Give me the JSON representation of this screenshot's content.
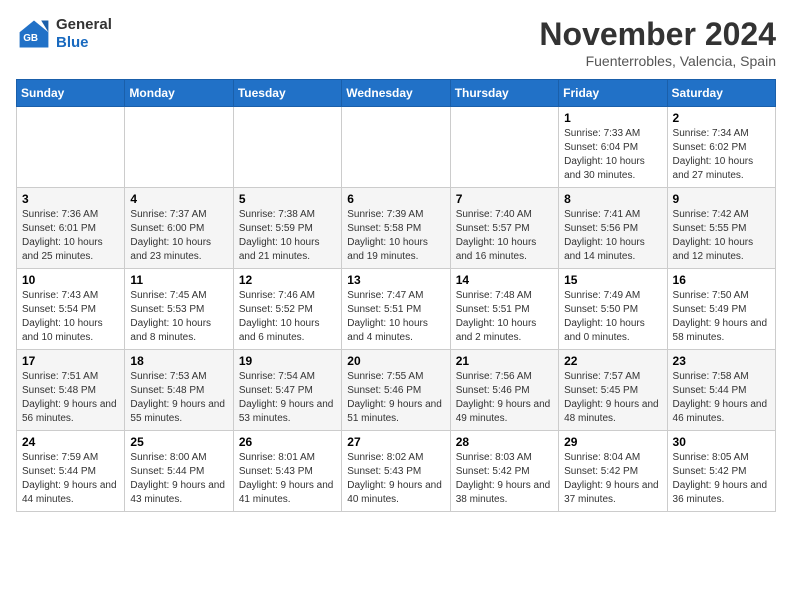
{
  "header": {
    "logo_line1": "General",
    "logo_line2": "Blue",
    "month": "November 2024",
    "location": "Fuenterrobles, Valencia, Spain"
  },
  "weekdays": [
    "Sunday",
    "Monday",
    "Tuesday",
    "Wednesday",
    "Thursday",
    "Friday",
    "Saturday"
  ],
  "weeks": [
    [
      {
        "day": "",
        "info": ""
      },
      {
        "day": "",
        "info": ""
      },
      {
        "day": "",
        "info": ""
      },
      {
        "day": "",
        "info": ""
      },
      {
        "day": "",
        "info": ""
      },
      {
        "day": "1",
        "info": "Sunrise: 7:33 AM\nSunset: 6:04 PM\nDaylight: 10 hours and 30 minutes."
      },
      {
        "day": "2",
        "info": "Sunrise: 7:34 AM\nSunset: 6:02 PM\nDaylight: 10 hours and 27 minutes."
      }
    ],
    [
      {
        "day": "3",
        "info": "Sunrise: 7:36 AM\nSunset: 6:01 PM\nDaylight: 10 hours and 25 minutes."
      },
      {
        "day": "4",
        "info": "Sunrise: 7:37 AM\nSunset: 6:00 PM\nDaylight: 10 hours and 23 minutes."
      },
      {
        "day": "5",
        "info": "Sunrise: 7:38 AM\nSunset: 5:59 PM\nDaylight: 10 hours and 21 minutes."
      },
      {
        "day": "6",
        "info": "Sunrise: 7:39 AM\nSunset: 5:58 PM\nDaylight: 10 hours and 19 minutes."
      },
      {
        "day": "7",
        "info": "Sunrise: 7:40 AM\nSunset: 5:57 PM\nDaylight: 10 hours and 16 minutes."
      },
      {
        "day": "8",
        "info": "Sunrise: 7:41 AM\nSunset: 5:56 PM\nDaylight: 10 hours and 14 minutes."
      },
      {
        "day": "9",
        "info": "Sunrise: 7:42 AM\nSunset: 5:55 PM\nDaylight: 10 hours and 12 minutes."
      }
    ],
    [
      {
        "day": "10",
        "info": "Sunrise: 7:43 AM\nSunset: 5:54 PM\nDaylight: 10 hours and 10 minutes."
      },
      {
        "day": "11",
        "info": "Sunrise: 7:45 AM\nSunset: 5:53 PM\nDaylight: 10 hours and 8 minutes."
      },
      {
        "day": "12",
        "info": "Sunrise: 7:46 AM\nSunset: 5:52 PM\nDaylight: 10 hours and 6 minutes."
      },
      {
        "day": "13",
        "info": "Sunrise: 7:47 AM\nSunset: 5:51 PM\nDaylight: 10 hours and 4 minutes."
      },
      {
        "day": "14",
        "info": "Sunrise: 7:48 AM\nSunset: 5:51 PM\nDaylight: 10 hours and 2 minutes."
      },
      {
        "day": "15",
        "info": "Sunrise: 7:49 AM\nSunset: 5:50 PM\nDaylight: 10 hours and 0 minutes."
      },
      {
        "day": "16",
        "info": "Sunrise: 7:50 AM\nSunset: 5:49 PM\nDaylight: 9 hours and 58 minutes."
      }
    ],
    [
      {
        "day": "17",
        "info": "Sunrise: 7:51 AM\nSunset: 5:48 PM\nDaylight: 9 hours and 56 minutes."
      },
      {
        "day": "18",
        "info": "Sunrise: 7:53 AM\nSunset: 5:48 PM\nDaylight: 9 hours and 55 minutes."
      },
      {
        "day": "19",
        "info": "Sunrise: 7:54 AM\nSunset: 5:47 PM\nDaylight: 9 hours and 53 minutes."
      },
      {
        "day": "20",
        "info": "Sunrise: 7:55 AM\nSunset: 5:46 PM\nDaylight: 9 hours and 51 minutes."
      },
      {
        "day": "21",
        "info": "Sunrise: 7:56 AM\nSunset: 5:46 PM\nDaylight: 9 hours and 49 minutes."
      },
      {
        "day": "22",
        "info": "Sunrise: 7:57 AM\nSunset: 5:45 PM\nDaylight: 9 hours and 48 minutes."
      },
      {
        "day": "23",
        "info": "Sunrise: 7:58 AM\nSunset: 5:44 PM\nDaylight: 9 hours and 46 minutes."
      }
    ],
    [
      {
        "day": "24",
        "info": "Sunrise: 7:59 AM\nSunset: 5:44 PM\nDaylight: 9 hours and 44 minutes."
      },
      {
        "day": "25",
        "info": "Sunrise: 8:00 AM\nSunset: 5:44 PM\nDaylight: 9 hours and 43 minutes."
      },
      {
        "day": "26",
        "info": "Sunrise: 8:01 AM\nSunset: 5:43 PM\nDaylight: 9 hours and 41 minutes."
      },
      {
        "day": "27",
        "info": "Sunrise: 8:02 AM\nSunset: 5:43 PM\nDaylight: 9 hours and 40 minutes."
      },
      {
        "day": "28",
        "info": "Sunrise: 8:03 AM\nSunset: 5:42 PM\nDaylight: 9 hours and 38 minutes."
      },
      {
        "day": "29",
        "info": "Sunrise: 8:04 AM\nSunset: 5:42 PM\nDaylight: 9 hours and 37 minutes."
      },
      {
        "day": "30",
        "info": "Sunrise: 8:05 AM\nSunset: 5:42 PM\nDaylight: 9 hours and 36 minutes."
      }
    ]
  ]
}
